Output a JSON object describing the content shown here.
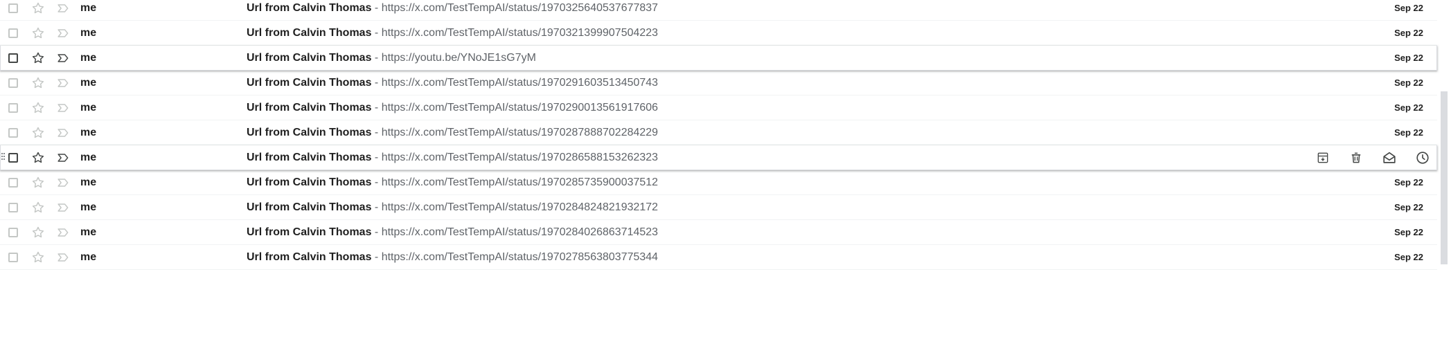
{
  "rows": [
    {
      "sender": "me",
      "subject": "Url from Calvin Thomas",
      "separator": " - ",
      "snippet": "https://x.com/TestTempAI/status/1970325640537677837",
      "date": "Sep 22",
      "state": "normal"
    },
    {
      "sender": "me",
      "subject": "Url from Calvin Thomas",
      "separator": " - ",
      "snippet": "https://x.com/TestTempAI/status/1970321399907504223",
      "date": "Sep 22",
      "state": "normal"
    },
    {
      "sender": "me",
      "subject": "Url from Calvin Thomas",
      "separator": " - ",
      "snippet": "https://youtu.be/YNoJE1sG7yM",
      "date": "Sep 22",
      "state": "highlighted"
    },
    {
      "sender": "me",
      "subject": "Url from Calvin Thomas",
      "separator": " - ",
      "snippet": "https://x.com/TestTempAI/status/1970291603513450743",
      "date": "Sep 22",
      "state": "normal"
    },
    {
      "sender": "me",
      "subject": "Url from Calvin Thomas",
      "separator": " - ",
      "snippet": "https://x.com/TestTempAI/status/1970290013561917606",
      "date": "Sep 22",
      "state": "normal"
    },
    {
      "sender": "me",
      "subject": "Url from Calvin Thomas",
      "separator": " - ",
      "snippet": "https://x.com/TestTempAI/status/1970287888702284229",
      "date": "Sep 22",
      "state": "normal"
    },
    {
      "sender": "me",
      "subject": "Url from Calvin Thomas",
      "separator": " - ",
      "snippet": "https://x.com/TestTempAI/status/1970286588153262323",
      "date": "Sep 22",
      "state": "hover"
    },
    {
      "sender": "me",
      "subject": "Url from Calvin Thomas",
      "separator": " - ",
      "snippet": "https://x.com/TestTempAI/status/1970285735900037512",
      "date": "Sep 22",
      "state": "normal"
    },
    {
      "sender": "me",
      "subject": "Url from Calvin Thomas",
      "separator": " - ",
      "snippet": "https://x.com/TestTempAI/status/1970284824821932172",
      "date": "Sep 22",
      "state": "normal"
    },
    {
      "sender": "me",
      "subject": "Url from Calvin Thomas",
      "separator": " - ",
      "snippet": "https://x.com/TestTempAI/status/1970284026863714523",
      "date": "Sep 22",
      "state": "normal"
    },
    {
      "sender": "me",
      "subject": "Url from Calvin Thomas",
      "separator": " - ",
      "snippet": "https://x.com/TestTempAI/status/1970278563803775344",
      "date": "Sep 22",
      "state": "normal"
    }
  ],
  "hover_actions": [
    "archive-icon",
    "delete-icon",
    "mark-as-read-icon",
    "snooze-icon"
  ],
  "icons": {
    "checkbox": "checkbox-icon",
    "star": "star-icon",
    "importance": "importance-marker-icon",
    "drag": "drag-handle-icon"
  },
  "colors": {
    "text_primary": "#1f1f1f",
    "text_secondary": "#5f6368",
    "icon_light": "#c4c7c5",
    "icon_dark": "#444746",
    "row_border": "#f1f3f4",
    "scrollbar_thumb": "#dadce0"
  }
}
